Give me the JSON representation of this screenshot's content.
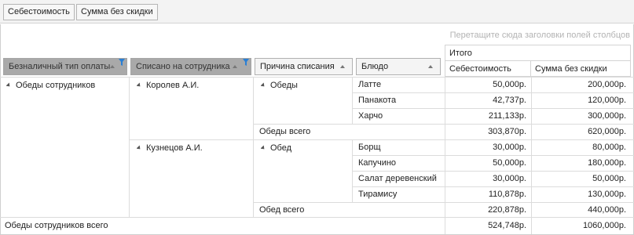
{
  "filter_bar": {
    "buttons": [
      "Себестоимость",
      "Сумма без скидки"
    ]
  },
  "hint": "Перетащите сюда заголовки полей столбцов",
  "row_headers": [
    {
      "label": "Безналичный тип оплаты",
      "filter": true
    },
    {
      "label": "Списано на сотрудника",
      "filter": true
    },
    {
      "label": "Причина списания",
      "filter": false
    },
    {
      "label": "Блюдо",
      "filter": false
    }
  ],
  "column_group": "Итого",
  "value_headers": [
    "Себестоимость",
    "Сумма без скидки"
  ],
  "groups": [
    {
      "payment": "Обеды сотрудников"
    }
  ],
  "employees": [
    "Королев А.И.",
    "Кузнецов А.И."
  ],
  "reasons": [
    "Обеды",
    "Обед"
  ],
  "dishes": [
    {
      "name": "Латте",
      "cost": "50,000р.",
      "sum": "200,000р."
    },
    {
      "name": "Панакота",
      "cost": "42,737р.",
      "sum": "120,000р."
    },
    {
      "name": "Харчо",
      "cost": "211,133р.",
      "sum": "300,000р."
    },
    {
      "name": "Борщ",
      "cost": "30,000р.",
      "sum": "80,000р."
    },
    {
      "name": "Капучино",
      "cost": "50,000р.",
      "sum": "180,000р."
    },
    {
      "name": "Салат деревенский",
      "cost": "30,000р.",
      "sum": "50,000р."
    },
    {
      "name": "Тирамису",
      "cost": "110,878р.",
      "sum": "130,000р."
    }
  ],
  "subtotals": [
    {
      "label": "Обеды всего",
      "cost": "303,870р.",
      "sum": "620,000р."
    },
    {
      "label": "Обед всего",
      "cost": "220,878р.",
      "sum": "440,000р."
    }
  ],
  "grand_total": {
    "label": "Обеды сотрудников всего",
    "cost": "524,748р.",
    "sum": "1060,000р."
  }
}
